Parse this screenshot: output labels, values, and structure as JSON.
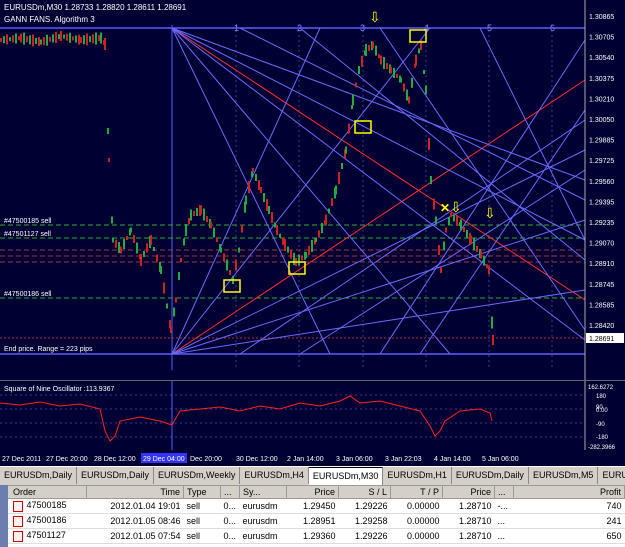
{
  "chart": {
    "header": "EURUSDm,M30  1.28733 1.28820 1.28611 1.28691",
    "indicator_name": "GANN FANS. Algorithm 3",
    "price_labels": [
      "1.30865",
      "1.30705",
      "1.30540",
      "1.30375",
      "1.30210",
      "1.30050",
      "1.29885",
      "1.29725",
      "1.29560",
      "1.29395",
      "1.29235",
      "1.29070",
      "1.28910",
      "1.28745",
      "1.28585",
      "1.28420"
    ],
    "current_price": "1.28691",
    "fan_numbers": [
      "1",
      "2",
      "3",
      "4",
      "5",
      "6"
    ],
    "order_labels": [
      "#47500185 sell",
      "#47501127 sell",
      "#47500186 sell"
    ],
    "range_text": "End price. Range = 223 pips"
  },
  "oscillator": {
    "label": "Square of Nine Oscillator :113.9367",
    "axis_labels": [
      "162.6272",
      "180",
      "90",
      "0.00",
      "-90",
      "-180",
      "-282.3966"
    ]
  },
  "time_axis": {
    "labels": [
      "27 Dec 2011",
      "27 Dec 20:00",
      "28 Dec 12:00",
      "29 Dec 04:00",
      "Dec 20:00",
      "30 Dec 12:00",
      "2 Jan 14:00",
      "3 Jan 06:00",
      "3 Jan 22:03",
      "4 Jan 14:00",
      "5 Jan 06:00"
    ]
  },
  "tabs": [
    "EURUSDm,Daily",
    "EURUSDm,Daily",
    "EURUSDm,Weekly",
    "EURUSDm,H4",
    "EURUSDm,M30",
    "EURUSDm,H1",
    "EURUSDm,Daily",
    "EURUSDm,M5",
    "EURU"
  ],
  "active_tab": 4,
  "orders": {
    "columns": [
      "Order",
      "Time",
      "Type",
      "...",
      "Sy...",
      "Price",
      "S / L",
      "T / P",
      "Price",
      "...",
      "Profit"
    ],
    "rows": [
      {
        "order": "47500185",
        "time": "2012.01.04 19:01",
        "type": "sell",
        "lots": "0...",
        "symbol": "eurusdm",
        "price": "1.29450",
        "sl": "1.29226",
        "tp": "0.00000",
        "cur": "1.28710",
        "sw": "-...",
        "profit": "740"
      },
      {
        "order": "47500186",
        "time": "2012.01.05 08:46",
        "type": "sell",
        "lots": "0...",
        "symbol": "eurusdm",
        "price": "1.28951",
        "sl": "1.29258",
        "tp": "0.00000",
        "cur": "1.28710",
        "sw": "...",
        "profit": "241"
      },
      {
        "order": "47501127",
        "time": "2012.01.05 07:54",
        "type": "sell",
        "lots": "0...",
        "symbol": "eurusdm",
        "price": "1.29360",
        "sl": "1.29226",
        "tp": "0.00000",
        "cur": "1.28710",
        "sw": "...",
        "profit": "650"
      }
    ]
  },
  "colors": {
    "background": "#000033",
    "grid": "#3a3a8a",
    "candle_up": "#22aa44",
    "candle_down": "#cc2222",
    "fan_red": "#ff3030",
    "fan_blue": "#6a6aff",
    "highlight": "#ffff00"
  }
}
